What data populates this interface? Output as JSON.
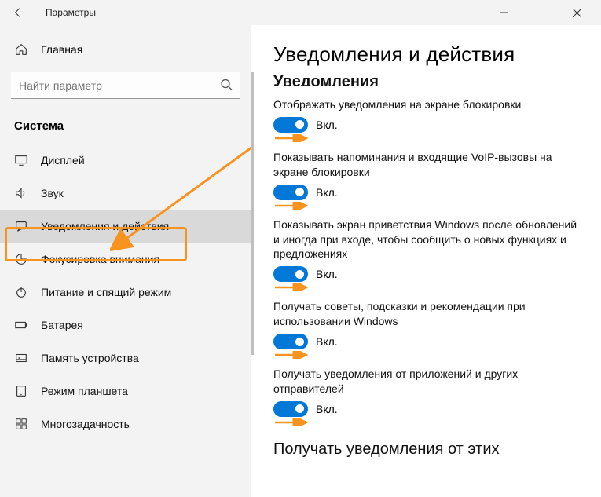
{
  "window": {
    "title": "Параметры"
  },
  "sidebar": {
    "home": "Главная",
    "search_placeholder": "Найти параметр",
    "category": "Система",
    "items": [
      {
        "icon": "display-icon",
        "label": "Дисплей"
      },
      {
        "icon": "sound-icon",
        "label": "Звук"
      },
      {
        "icon": "notifications-icon",
        "label": "Уведомления и действия",
        "selected": true
      },
      {
        "icon": "focus-icon",
        "label": "Фокусировка внимания"
      },
      {
        "icon": "power-icon",
        "label": "Питание и спящий режим"
      },
      {
        "icon": "battery-icon",
        "label": "Батарея"
      },
      {
        "icon": "storage-icon",
        "label": "Память устройства"
      },
      {
        "icon": "tablet-icon",
        "label": "Режим планшета"
      },
      {
        "icon": "multitask-icon",
        "label": "Многозадачность"
      }
    ]
  },
  "content": {
    "page_title": "Уведомления и действия",
    "subhead_partial": "Уведомления",
    "settings": [
      {
        "desc": "Отображать уведомления на экране блокировки",
        "state": "Вкл."
      },
      {
        "desc": "Показывать напоминания и входящие VoIP-вызовы на экране блокировки",
        "state": "Вкл."
      },
      {
        "desc": "Показывать экран приветствия Windows после обновлений и иногда при входе, чтобы сообщить о новых функциях и предложениях",
        "state": "Вкл."
      },
      {
        "desc": "Получать советы, подсказки и рекомендации при использовании Windows",
        "state": "Вкл."
      },
      {
        "desc": "Получать уведомления от приложений и других отправителей",
        "state": "Вкл."
      }
    ],
    "bottom_section": "Получать уведомления от этих"
  },
  "colors": {
    "accent": "#0078d7",
    "annotation": "#f7931e"
  }
}
